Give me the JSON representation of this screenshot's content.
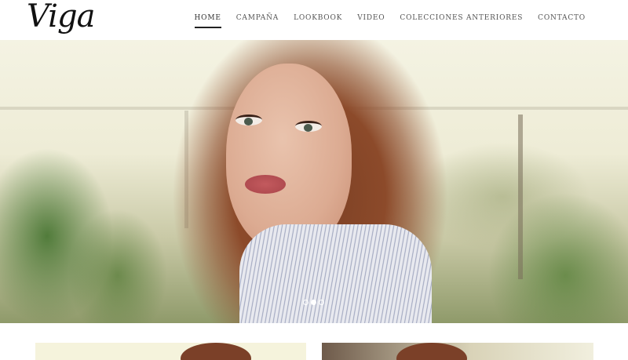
{
  "brand": {
    "logo_text": "Viga"
  },
  "nav": {
    "items": [
      {
        "label": "HOME",
        "active": true
      },
      {
        "label": "CAMPAÑA",
        "active": false
      },
      {
        "label": "LOOKBOOK",
        "active": false
      },
      {
        "label": "VIDEO",
        "active": false
      },
      {
        "label": "COLECCIONES ANTERIORES",
        "active": false
      },
      {
        "label": "CONTACTO",
        "active": false
      }
    ]
  },
  "slider": {
    "slide_count": 3,
    "active_index": 1
  },
  "colors": {
    "nav_text": "#555555",
    "nav_active_underline": "#222222",
    "background": "#ffffff"
  }
}
